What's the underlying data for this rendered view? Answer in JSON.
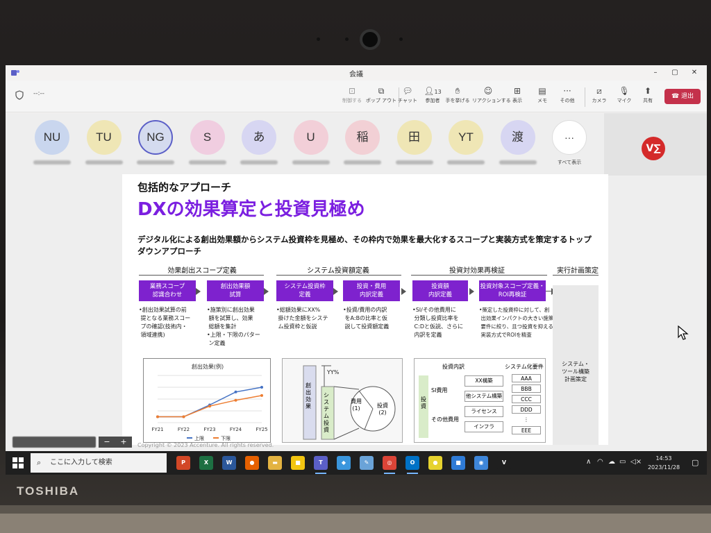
{
  "device": {
    "brand": "TOSHIBA"
  },
  "window": {
    "title": "会議"
  },
  "meeting": {
    "timer": "--:--",
    "toolbar": [
      {
        "id": "record",
        "label": "制御する",
        "icon": "record-icon"
      },
      {
        "id": "popout",
        "label": "ポップ アウト",
        "icon": "popout-icon"
      },
      {
        "id": "chat",
        "label": "チャット",
        "icon": "chat-icon"
      },
      {
        "id": "people",
        "label": "参加者",
        "icon": "people-icon",
        "count": "13"
      },
      {
        "id": "raise-hand",
        "label": "手を挙げる",
        "icon": "hand-icon"
      },
      {
        "id": "reactions",
        "label": "リアクションする",
        "icon": "smile-icon"
      },
      {
        "id": "view",
        "label": "表示",
        "icon": "grid-icon"
      },
      {
        "id": "notes",
        "label": "メモ",
        "icon": "notes-icon"
      },
      {
        "id": "more",
        "label": "その他",
        "icon": "more-icon"
      },
      {
        "id": "camera",
        "label": "カメラ",
        "icon": "camera-off-icon"
      },
      {
        "id": "mic",
        "label": "マイク",
        "icon": "mic-off-icon"
      },
      {
        "id": "share",
        "label": "共有",
        "icon": "share-icon"
      }
    ],
    "leave_label": "退出",
    "participants": [
      {
        "initials": "NU",
        "color": "#c9d6ee"
      },
      {
        "initials": "TU",
        "color": "#efe6b5"
      },
      {
        "initials": "NG",
        "color": "#d4dbef"
      },
      {
        "initials": "S",
        "color": "#f0cde0"
      },
      {
        "initials": "あ",
        "color": "#d7d6f2"
      },
      {
        "initials": "U",
        "color": "#f2cfd8"
      },
      {
        "initials": "稲",
        "color": "#f2d0d5"
      },
      {
        "initials": "田",
        "color": "#efe6b5"
      },
      {
        "initials": "YT",
        "color": "#efe6b5"
      },
      {
        "initials": "渡",
        "color": "#d7d6f2"
      }
    ],
    "see_all": {
      "icon": "···",
      "label": "すべて表示"
    },
    "self_view_logo": "V∑"
  },
  "slide": {
    "kicker": "包括的なアプローチ",
    "title": "DXの効果算定と投資見極め",
    "lead": "デジタル化による創出効果額からシステム投資枠を見極め、その枠内で効果を最大化するスコープと実装方式を策定するトップダウンアプローチ",
    "phases": [
      "効果創出スコープ定義",
      "システム投資額定義",
      "投資対効果再検証",
      "実行計画策定"
    ],
    "steps": [
      {
        "label": "業務スコープ\n認識合わせ",
        "desc": "•創出効果試算の前\n 提となる業務スコー\n プの確認(技術内・\n 領域連携)"
      },
      {
        "label": "創出効果額\n試算",
        "desc": "•施策別に創出効果\n 額を試算し、効果\n 総額を集計\n•上限・下限のパター\n ン定義"
      },
      {
        "label": "システム投資枠\n定義",
        "desc": "•総額効果にXX%\n 掛けた金額をシステ\n ム投資枠と仮説"
      },
      {
        "label": "投資・費用\n内訳定義",
        "desc": "•投資/費用の内訳\n をA:Bの比率と仮\n 説して投資額定義"
      },
      {
        "label": "投資額\n内訳定義",
        "desc": "•SI/その他費用に\n 分類し投資比率を\n C:Dと仮説、さらに\n 内訳を定義"
      },
      {
        "label": "投資対象スコープ定義・\nROI再検証",
        "desc": "•策定した投資枠に対して、創\n 出効果インパクトの大きい施策\n 要件に絞り、且つ投資を抑える\n 実装方式でROIを精査"
      }
    ],
    "exec_label": "システム・\nツール構築\n計画策定",
    "copyright": "Copyright © 2023 Accenture. All rights reserved.",
    "diagram": {
      "yy": "YY%",
      "effect": "創\n出\n効\n果",
      "sys_invest": "シ\nス\nテ\nム\n投\n資",
      "cost": "費用\n(1)",
      "invest": "投資\n(2)"
    },
    "invest_table": {
      "h1": "投資内訳",
      "h2": "システム化要件",
      "invest_label": "投\n資",
      "si": "SI費用",
      "other": "その他費用",
      "items": [
        "XX構築",
        "他システム構築",
        "ライセンス",
        "インフラ"
      ],
      "reqs": [
        "AAA",
        "BBB",
        "CCC",
        "DDD",
        "⋮",
        "EEE"
      ]
    }
  },
  "chart_data": {
    "type": "line",
    "title": "創出効果(例)",
    "categories": [
      "FY21",
      "FY22",
      "FY23",
      "FY24",
      "FY25"
    ],
    "series": [
      {
        "name": "上限",
        "color": "#4472c4",
        "values": [
          1,
          1,
          3,
          5.2,
          6
        ]
      },
      {
        "name": "下限",
        "color": "#ed7d31",
        "values": [
          1,
          1,
          2.8,
          3.8,
          4.6
        ]
      }
    ],
    "ylim": [
      0,
      8
    ],
    "grid": true,
    "legend": "bottom"
  },
  "taskbar": {
    "search_placeholder": "ここに入力して検索",
    "apps": [
      {
        "name": "powerpoint-icon",
        "color": "#d24726",
        "glyph": "P"
      },
      {
        "name": "excel-icon",
        "color": "#1d6f42",
        "glyph": "X"
      },
      {
        "name": "word-icon",
        "color": "#2b579a",
        "glyph": "W"
      },
      {
        "name": "firefox-icon",
        "color": "#e66000",
        "glyph": "●"
      },
      {
        "name": "explorer-icon",
        "color": "#e3b341",
        "glyph": "▬"
      },
      {
        "name": "sticky-notes-icon",
        "color": "#f2c511",
        "glyph": "■"
      },
      {
        "name": "teams-icon",
        "color": "#5b5fc7",
        "glyph": "T"
      },
      {
        "name": "azure-icon",
        "color": "#3a96dd",
        "glyph": "◆"
      },
      {
        "name": "paint-icon",
        "color": "#6aa3d8",
        "glyph": "✎"
      },
      {
        "name": "chrome-icon",
        "color": "#db4437",
        "glyph": "◎"
      },
      {
        "name": "outlook-icon",
        "color": "#0072c6",
        "glyph": "O"
      },
      {
        "name": "yellow-app-icon",
        "color": "#e6d22e",
        "glyph": "●"
      },
      {
        "name": "blue-app-icon",
        "color": "#2f7bd6",
        "glyph": "■"
      },
      {
        "name": "globe-app-icon",
        "color": "#3e86d9",
        "glyph": "◉"
      },
      {
        "name": "v-app-icon",
        "color": "#1f1f1f",
        "glyph": "V"
      }
    ],
    "time": "14:53",
    "date": "2023/11/28"
  }
}
